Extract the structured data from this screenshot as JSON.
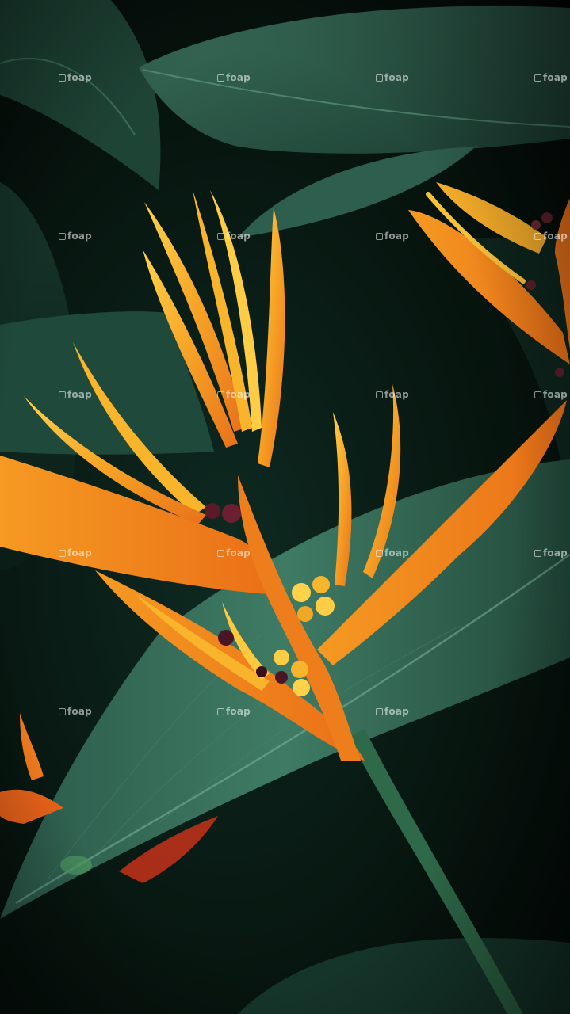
{
  "photo": {
    "subject": "heliconia flower",
    "colors": {
      "petal_orange": "#f08a1c",
      "petal_yellow": "#f7b72e",
      "leaf_green": "#2d5a4a",
      "leaf_light": "#3f7a63",
      "background": "#07150f",
      "bud_purple": "#5a1f2c"
    }
  },
  "watermark": {
    "text": "foap",
    "icon": "camera-icon"
  }
}
